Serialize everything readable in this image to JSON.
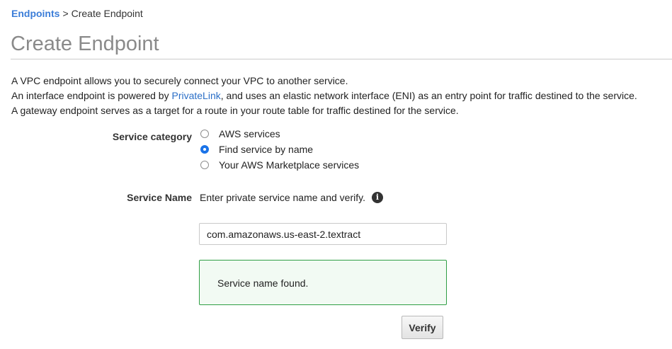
{
  "breadcrumb": {
    "parent": "Endpoints",
    "separator": ">",
    "current": "Create Endpoint"
  },
  "page_title": "Create Endpoint",
  "intro": {
    "line1": "A VPC endpoint allows you to securely connect your VPC to another service.",
    "line2_prefix": "An interface endpoint is powered by ",
    "line2_link": "PrivateLink",
    "line2_suffix": ", and uses an elastic network interface (ENI) as an entry point for traffic destined to the service.",
    "line3": "A gateway endpoint serves as a target for a route in your route table for traffic destined for the service."
  },
  "service_category": {
    "label": "Service category",
    "options": [
      {
        "label": "AWS services",
        "selected": false
      },
      {
        "label": "Find service by name",
        "selected": true
      },
      {
        "label": "Your AWS Marketplace services",
        "selected": false
      }
    ]
  },
  "service_name": {
    "label": "Service Name",
    "hint": "Enter private service name and verify.",
    "info_icon": "info-icon",
    "value": "com.amazonaws.us-east-2.textract"
  },
  "status": {
    "message": "Service name found.",
    "color": "#2f9e44"
  },
  "verify_button": {
    "label": "Verify"
  },
  "colors": {
    "link": "#3b7dd8",
    "title": "#8a8a8a",
    "radio_selected": "#1a73e8"
  }
}
